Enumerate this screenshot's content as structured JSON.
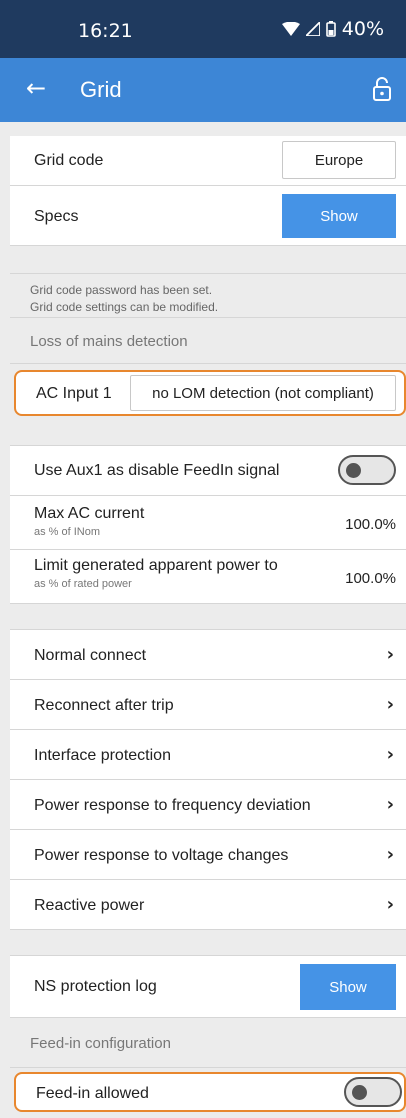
{
  "status_bar": {
    "time": "16:21",
    "battery": "40%"
  },
  "app_bar": {
    "title": "Grid",
    "back_icon": "arrow-left-icon",
    "lock_icon": "lock-open-icon"
  },
  "grid_code": {
    "label": "Grid code",
    "value": "Europe"
  },
  "specs": {
    "label": "Specs",
    "button": "Show"
  },
  "info_text": {
    "line1": "Grid code password has been set.",
    "line2": "Grid code settings can be modified."
  },
  "lom": {
    "section_title": "Loss of mains detection",
    "label": "AC Input 1",
    "value": "no LOM detection (not compliant)"
  },
  "aux1": {
    "label": "Use Aux1 as disable FeedIn signal",
    "enabled": false
  },
  "max_ac_current": {
    "label": "Max AC current",
    "sub": "as % of INom",
    "value": "100.0%"
  },
  "limit_power": {
    "label": "Limit generated apparent power to",
    "sub": "as % of rated power",
    "value": "100.0%"
  },
  "menu_items": [
    {
      "label": "Normal connect"
    },
    {
      "label": "Reconnect after trip"
    },
    {
      "label": "Interface protection"
    },
    {
      "label": "Power response to frequency deviation"
    },
    {
      "label": "Power response to voltage changes"
    },
    {
      "label": "Reactive power"
    }
  ],
  "ns_log": {
    "label": "NS protection log",
    "button": "Show"
  },
  "feedin": {
    "section_title": "Feed-in configuration",
    "label": "Feed-in allowed",
    "enabled": false
  },
  "colors": {
    "status_bar": "#1f3a5f",
    "app_bar": "#3d86d6",
    "button": "#4593e6",
    "highlight": "#e8872e"
  }
}
